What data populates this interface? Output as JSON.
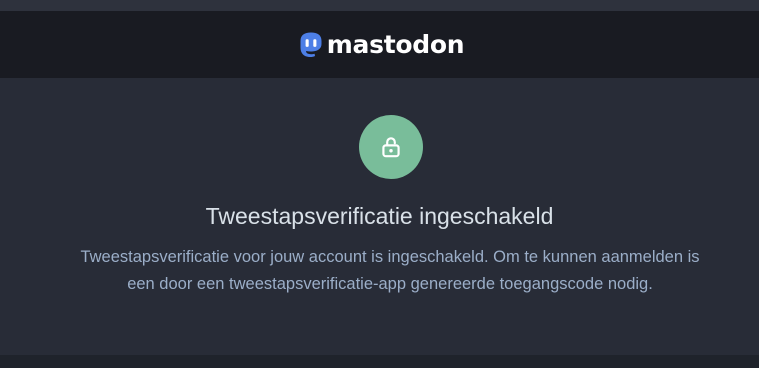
{
  "header": {
    "logo_text": "mastodon",
    "logo_icon": "mastodon-logo-icon"
  },
  "main": {
    "icon": "lock-icon",
    "title": "Tweestapsverificatie ingeschakeld",
    "description": "Tweestapsverificatie voor jouw account is ingeschakeld. Om te kunnen aanmelden is een door een tweestapsverificatie-app genereerde toegangscode nodig."
  },
  "colors": {
    "header_bg": "#191b22",
    "page_bg": "#282c37",
    "accent_green": "#79bd9a",
    "brand_blue": "#6364ff",
    "title_text": "#d9e1e8",
    "description_text": "#9baec8"
  }
}
